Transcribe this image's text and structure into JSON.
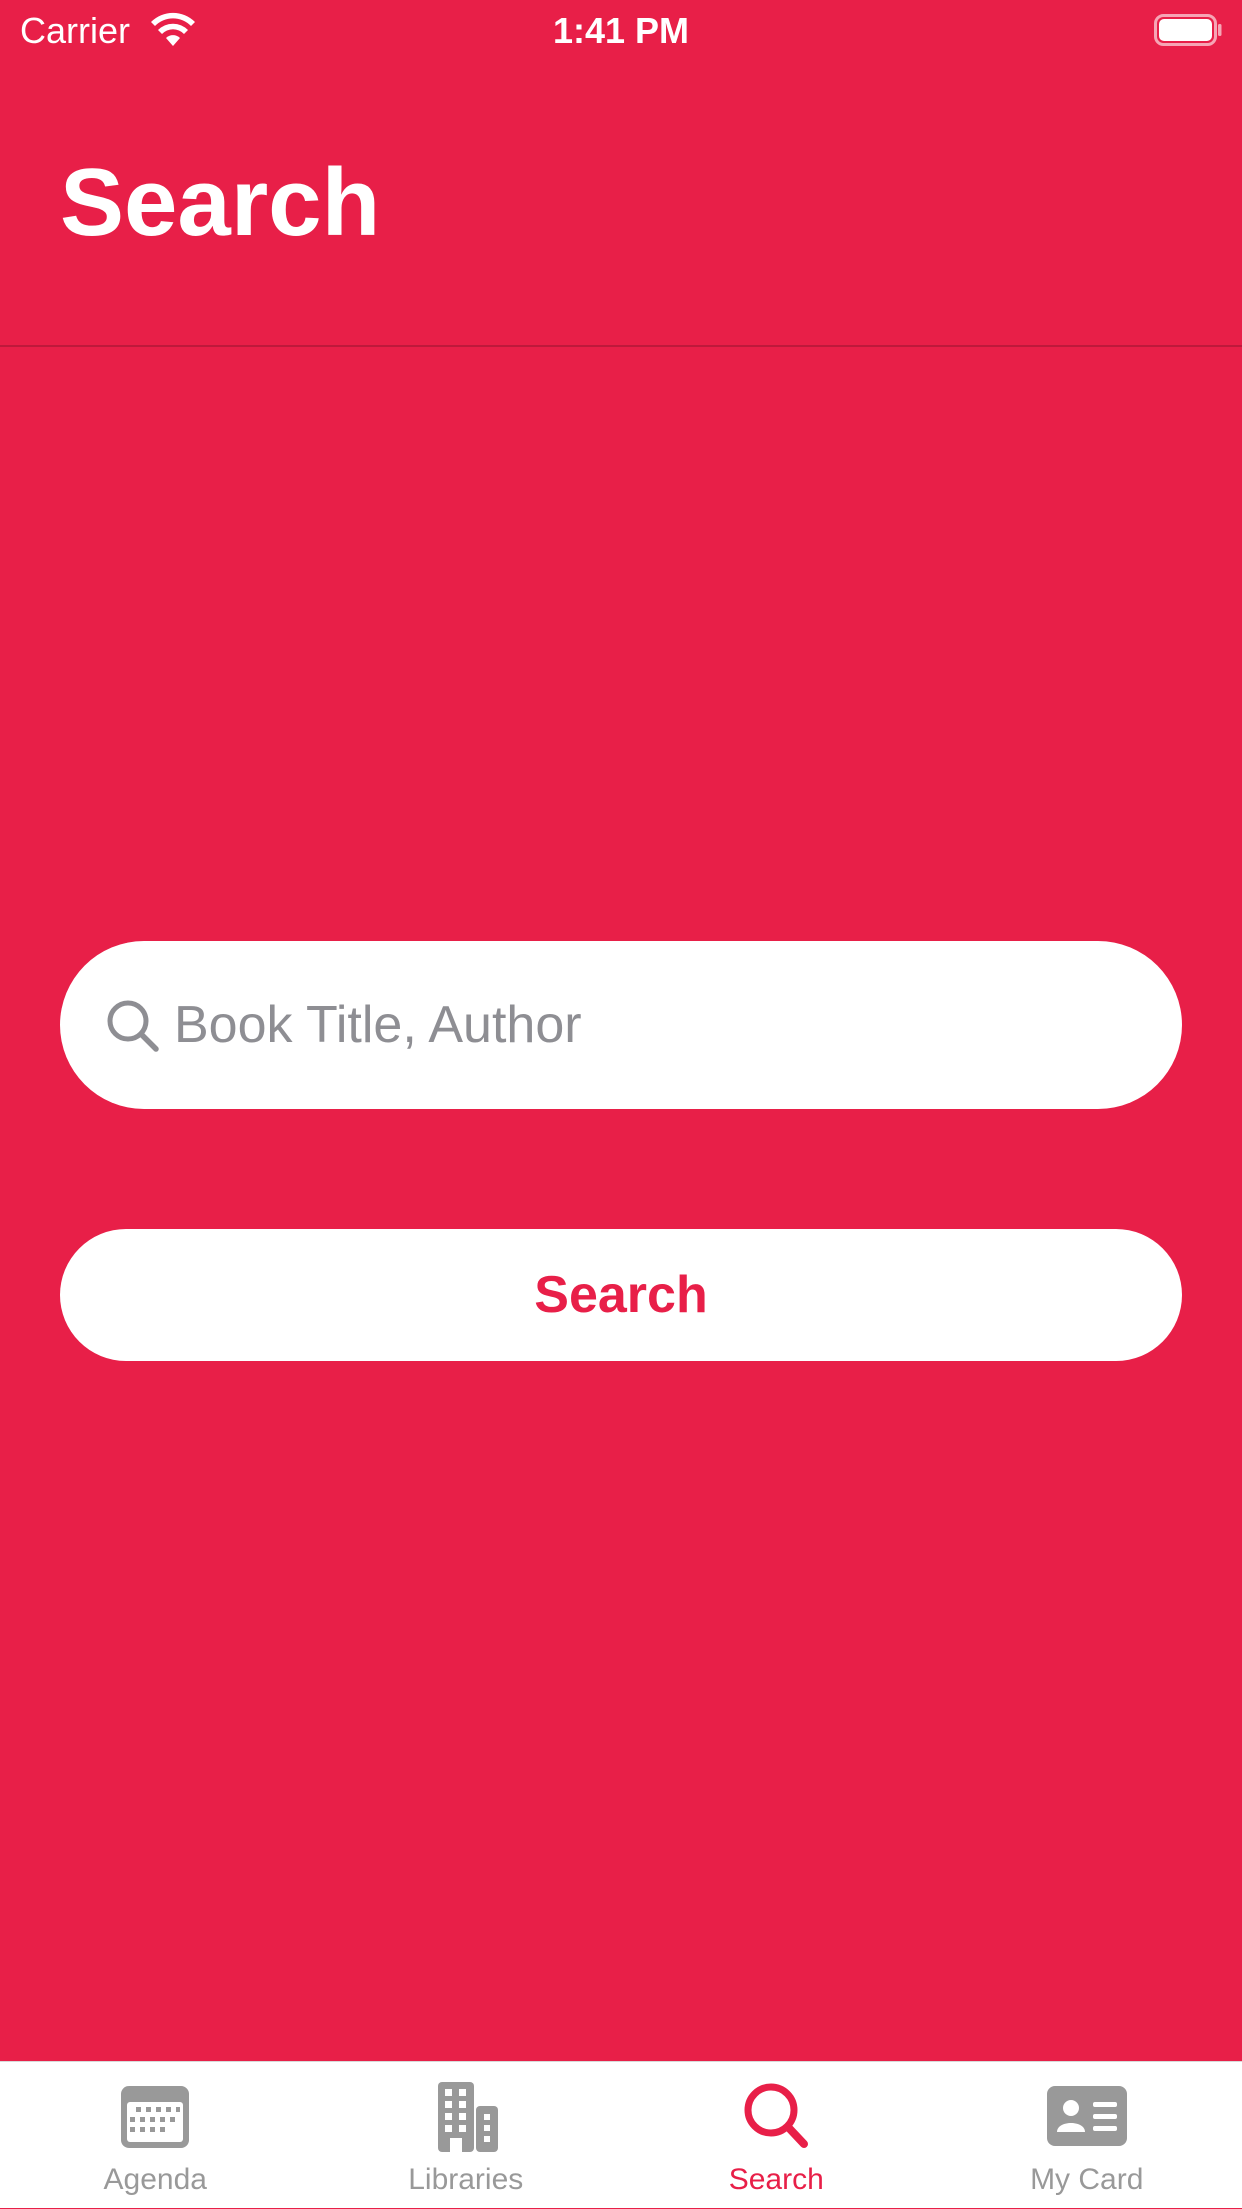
{
  "status_bar": {
    "carrier": "Carrier",
    "time": "1:41 PM",
    "wifi_icon": "wifi-icon",
    "battery_icon": "battery-icon"
  },
  "header": {
    "title": "Search"
  },
  "search_field": {
    "placeholder": "Book Title, Author",
    "value": "",
    "icon": "magnifying-glass-icon"
  },
  "search_button": {
    "label": "Search"
  },
  "tab_bar": {
    "tabs": [
      {
        "label": "Agenda",
        "icon": "calendar-icon",
        "selected": false
      },
      {
        "label": "Libraries",
        "icon": "buildings-icon",
        "selected": false
      },
      {
        "label": "Search",
        "icon": "magnifying-glass-icon",
        "selected": true
      },
      {
        "label": "My Card",
        "icon": "id-card-icon",
        "selected": false
      }
    ]
  },
  "colors": {
    "accent": "#E81F48",
    "background": "#E81F48",
    "surface": "#FFFFFF",
    "inactive_tab": "#999999",
    "placeholder": "#8E8E93"
  }
}
